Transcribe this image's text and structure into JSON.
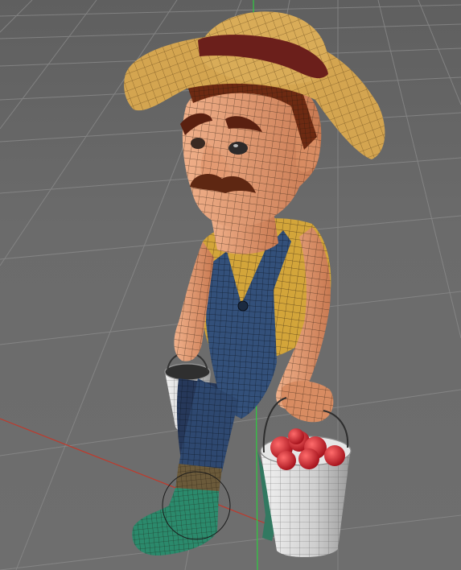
{
  "viewport": {
    "scene": "3d-character-wireframe",
    "mode": "perspective"
  },
  "colors": {
    "background": "#6a6a6a",
    "grid": "#8a8a8a",
    "axis_x": "#c0392b",
    "axis_y": "#2ecc40",
    "wire": "#2a1c10",
    "skin": "#e7a07a",
    "shirt": "#d3a53a",
    "overalls": "#33507a",
    "hat": "#d4a550",
    "hat_band": "#6b1f1b",
    "hair": "#6d2a12",
    "boot": "#2b8a6c",
    "bucket": "#d9d9d9",
    "tomato": "#d11e2a"
  },
  "icons": [
    "move-gizmo-icon"
  ]
}
